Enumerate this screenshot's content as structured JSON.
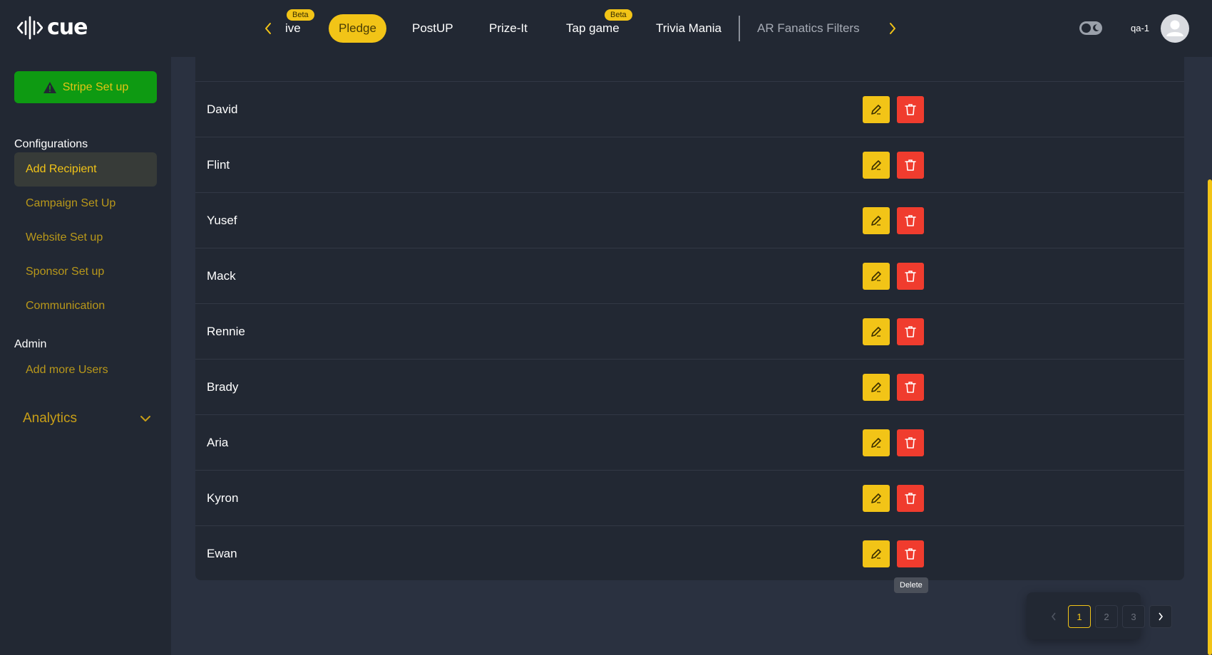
{
  "header": {
    "logo_text": "cue",
    "tabs": [
      {
        "label": "ive",
        "beta": "Beta"
      },
      {
        "label": "Pledge",
        "active": true
      },
      {
        "label": "PostUP"
      },
      {
        "label": "Prize-It"
      },
      {
        "label": "Tap game",
        "beta": "Beta"
      },
      {
        "label": "Trivia Mania"
      },
      {
        "label": "AR Fanatics Filters"
      }
    ],
    "user_name": "qa-1"
  },
  "sidebar": {
    "stripe_label": "Stripe Set up",
    "config_heading": "Configurations",
    "config_items": [
      "Add Recipient",
      "Campaign Set Up",
      "Website Set up",
      "Sponsor Set up",
      "Communication"
    ],
    "admin_heading": "Admin",
    "admin_items": [
      "Add more Users"
    ],
    "analytics_label": "Analytics"
  },
  "table": {
    "rows": [
      "David",
      "Flint",
      "Yusef",
      "Mack",
      "Rennie",
      "Brady",
      "Aria",
      "Kyron",
      "Ewan"
    ]
  },
  "tooltip": "Delete",
  "pagination": {
    "pages": [
      "1",
      "2",
      "3"
    ],
    "current": "1"
  },
  "colors": {
    "accent": "#f2c417",
    "danger": "#f03c2e",
    "success": "#0e9a12",
    "background": "#2a3140",
    "panel": "#222833"
  }
}
